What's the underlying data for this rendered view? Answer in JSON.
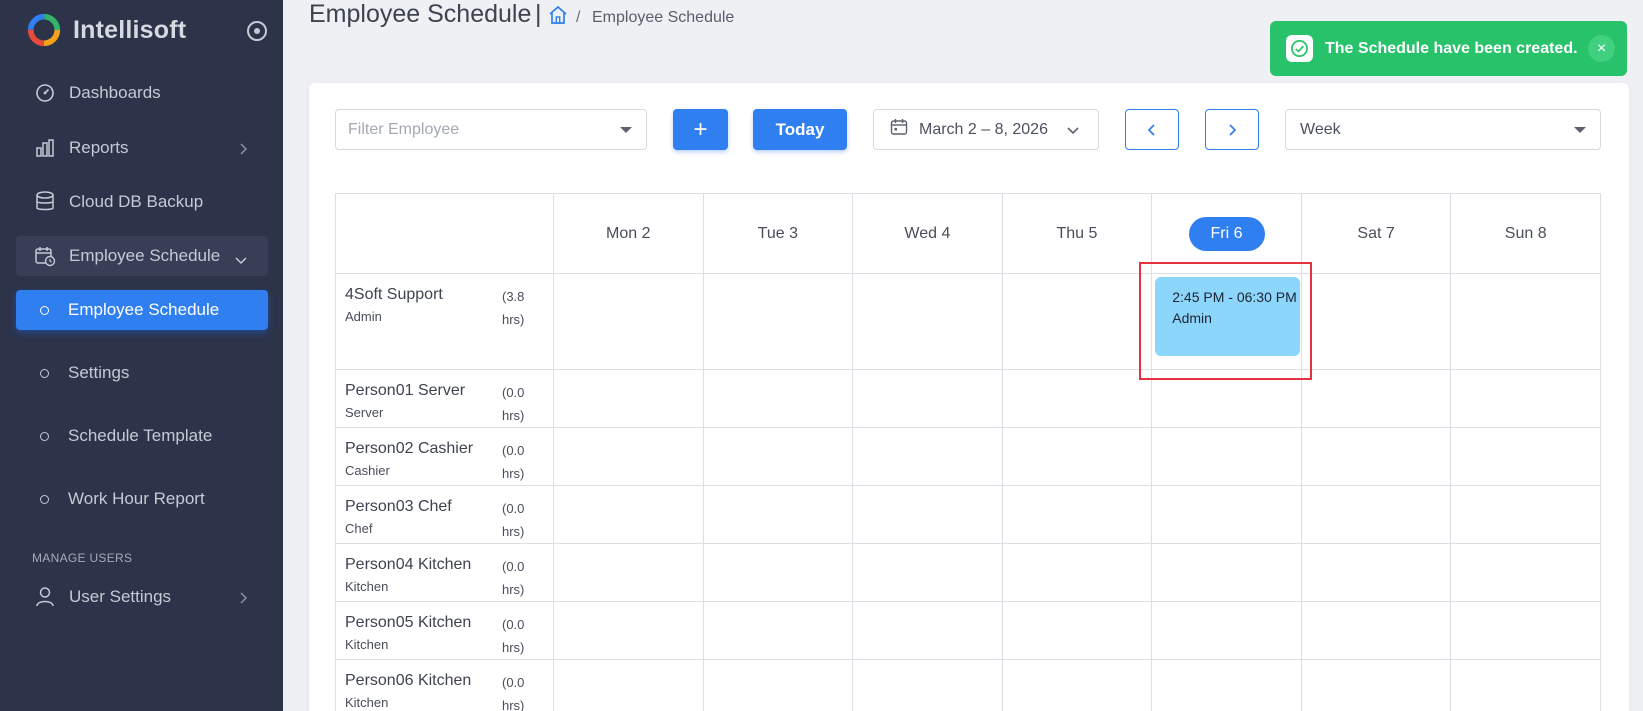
{
  "app": {
    "name": "Intellisoft"
  },
  "sidebar": {
    "items": [
      {
        "label": "Dashboards",
        "icon": "gauge-icon"
      },
      {
        "label": "Reports",
        "icon": "bar-chart-icon"
      },
      {
        "label": "Cloud DB Backup",
        "icon": "database-icon"
      },
      {
        "label": "Employee Schedule",
        "icon": "calendar-clock-icon"
      },
      {
        "label": "Employee Schedule"
      },
      {
        "label": "Settings"
      },
      {
        "label": "Schedule Template"
      },
      {
        "label": "Work Hour Report"
      }
    ],
    "section_label": "MANAGE USERS",
    "user_settings": "User Settings"
  },
  "header": {
    "title": "Employee Schedule",
    "separator": "|",
    "slash": "/",
    "breadcrumb": "Employee Schedule"
  },
  "toast": {
    "message": "The Schedule have been created.",
    "close": "×"
  },
  "toolbar": {
    "filter_placeholder": "Filter Employee",
    "add_label": "+",
    "today_label": "Today",
    "date_range": "March 2 – 8, 2026",
    "view": "Week"
  },
  "days": [
    "Mon 2",
    "Tue 3",
    "Wed 4",
    "Thu 5",
    "Fri 6",
    "Sat 7",
    "Sun 8"
  ],
  "today_index": 4,
  "employees": [
    {
      "name": "4Soft Support",
      "role": "Admin",
      "hours": "(3.8 hrs)"
    },
    {
      "name": "Person01 Server",
      "role": "Server",
      "hours": "(0.0 hrs)"
    },
    {
      "name": "Person02 Cashier",
      "role": "Cashier",
      "hours": "(0.0 hrs)"
    },
    {
      "name": "Person03 Chef",
      "role": "Chef",
      "hours": "(0.0 hrs)"
    },
    {
      "name": "Person04 Kitchen",
      "role": "Kitchen",
      "hours": "(0.0 hrs)"
    },
    {
      "name": "Person05 Kitchen",
      "role": "Kitchen",
      "hours": "(0.0 hrs)"
    },
    {
      "name": "Person06 Kitchen",
      "role": "Kitchen",
      "hours": "(0.0 hrs)"
    }
  ],
  "event": {
    "time": "2:45 PM - 06:30 PM",
    "role": "Admin",
    "employee_index": 0,
    "day_index": 4
  },
  "colors": {
    "accent": "#2f7ff0",
    "sidebar": "#2d3348",
    "toast": "#27c26a",
    "event": "#8cd5fb",
    "highlight": "#e53242"
  }
}
